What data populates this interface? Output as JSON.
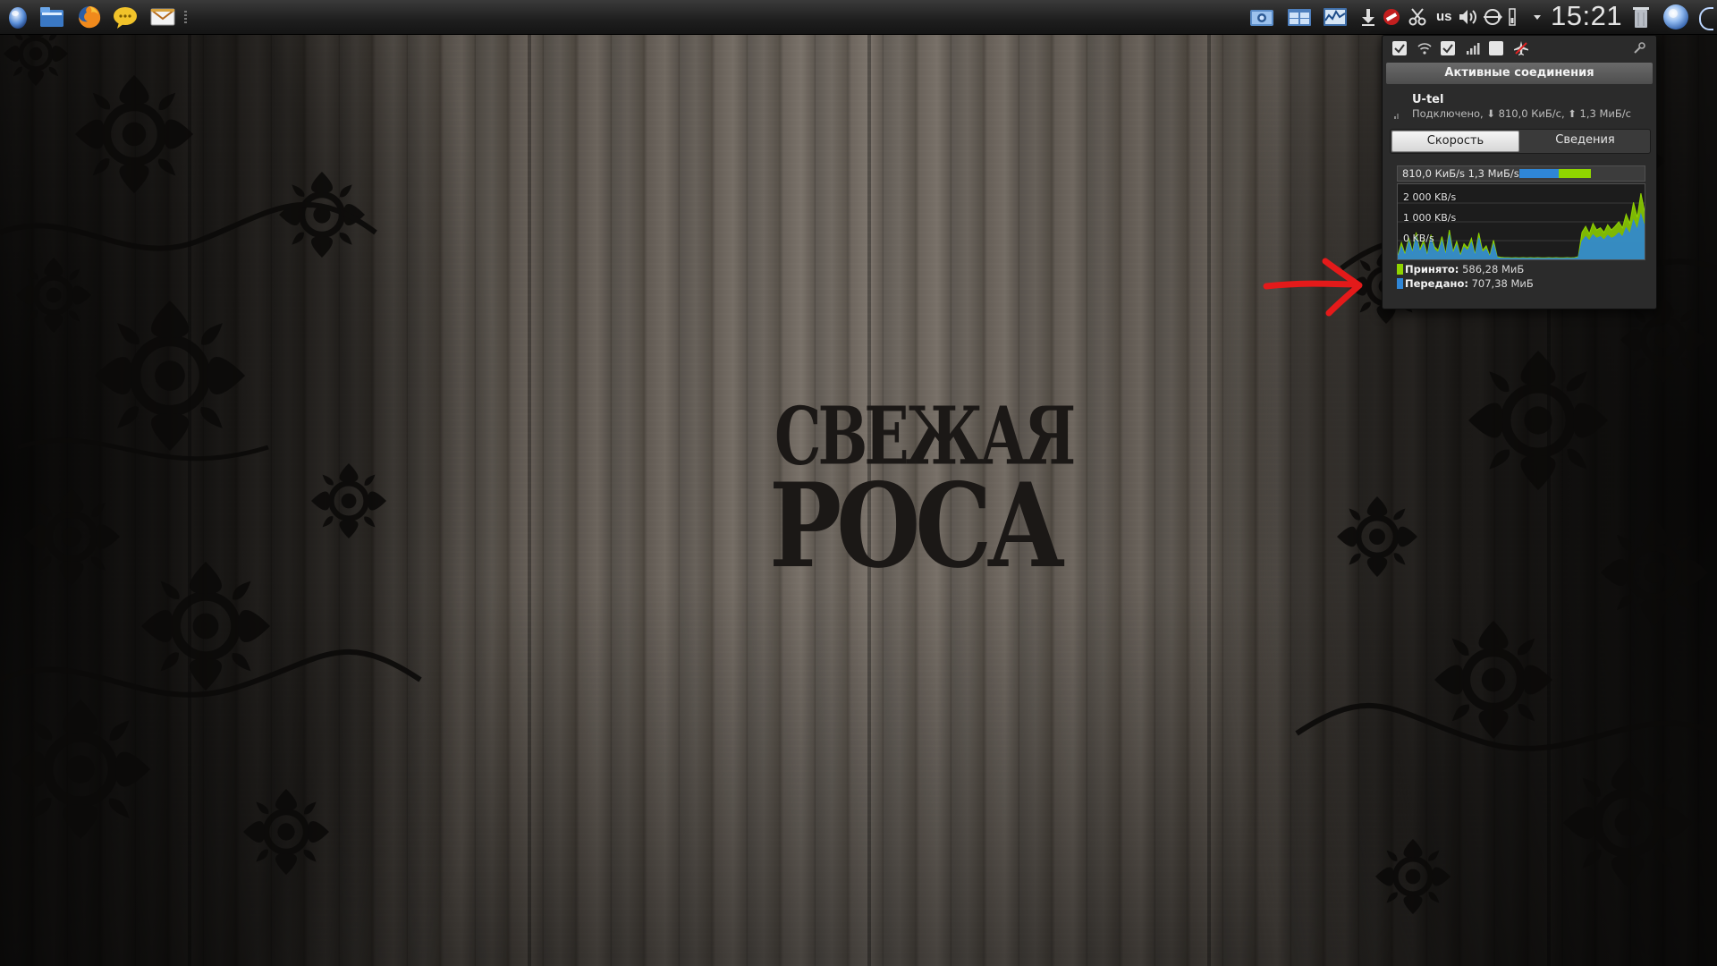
{
  "colors": {
    "received": "#8fd400",
    "sent": "#2f86d6",
    "annotation_arrow": "#e41a1a"
  },
  "panel": {
    "launchers": [
      {
        "icon": "rosa-app-launcher-icon"
      },
      {
        "icon": "file-manager-icon"
      },
      {
        "icon": "firefox-icon"
      },
      {
        "icon": "chat-icon"
      },
      {
        "icon": "mail-icon"
      }
    ],
    "tray": [
      {
        "icon": "screenshot-icon"
      },
      {
        "icon": "window-switcher-icon"
      },
      {
        "icon": "system-monitor-icon"
      },
      {
        "icon": "download-icon"
      },
      {
        "icon": "no-entry-icon"
      },
      {
        "icon": "clipboard-scissors-icon"
      },
      {
        "icon": "volume-icon"
      },
      {
        "icon": "network-icon"
      },
      {
        "icon": "battery-icon"
      },
      {
        "icon": "tray-expand-icon"
      },
      {
        "icon": "trash-icon"
      },
      {
        "icon": "rosa-icon"
      }
    ],
    "keyboard_layout": "us",
    "clock": "15:21"
  },
  "wallpaper": {
    "logo_line1": "СВЕЖАЯ",
    "logo_line2": "РОСА"
  },
  "network_popup": {
    "header": "Активные соединения",
    "connection": {
      "name": "U-tel",
      "status": "Подключено, ⬇ 810,0 КиБ/с, ⬆ 1,3 МиБ/с"
    },
    "tabs": [
      {
        "label": "Скорость",
        "active": true
      },
      {
        "label": "Сведения",
        "active": false
      }
    ],
    "speed_bar_label": "810,0 КиБ/s 1,3 МиБ/s",
    "graph_labels": {
      "top": "2 000 KB/s",
      "mid": "1 000 KB/s",
      "bottom": "0 KB/s"
    },
    "legend": {
      "received_label": "Принято:",
      "received_value": "586,28 МиБ",
      "sent_label": "Передано:",
      "sent_value": "707,38 МиБ"
    }
  },
  "chart_data": {
    "type": "area",
    "ylim": [
      0,
      2500
    ],
    "series": [
      {
        "name": "Принято",
        "values": [
          120,
          560,
          180,
          720,
          260,
          900,
          310,
          650,
          150,
          820,
          420,
          300,
          760,
          180,
          980,
          250,
          600,
          140,
          520,
          380,
          700,
          160,
          880,
          300,
          450,
          120,
          640,
          90,
          70,
          60,
          60,
          50,
          60,
          55,
          60,
          50,
          60,
          55,
          60,
          55,
          50,
          60,
          55,
          60,
          50,
          55,
          60,
          55,
          60,
          90,
          900,
          1100,
          850,
          1200,
          980,
          1050,
          900,
          1150,
          980,
          1100,
          1250,
          1050,
          1500,
          1200,
          1900,
          1400,
          2200,
          1600
        ]
      },
      {
        "name": "Передано",
        "values": [
          80,
          420,
          120,
          600,
          200,
          760,
          240,
          500,
          100,
          700,
          320,
          220,
          620,
          120,
          820,
          180,
          480,
          90,
          400,
          280,
          560,
          110,
          720,
          220,
          340,
          80,
          500,
          60,
          40,
          35,
          35,
          30,
          35,
          30,
          35,
          30,
          35,
          30,
          35,
          30,
          30,
          35,
          30,
          35,
          30,
          30,
          35,
          30,
          35,
          60,
          600,
          760,
          620,
          820,
          700,
          760,
          640,
          800,
          700,
          760,
          880,
          740,
          1050,
          840,
          1300,
          980,
          1500,
          1100
        ]
      }
    ]
  }
}
